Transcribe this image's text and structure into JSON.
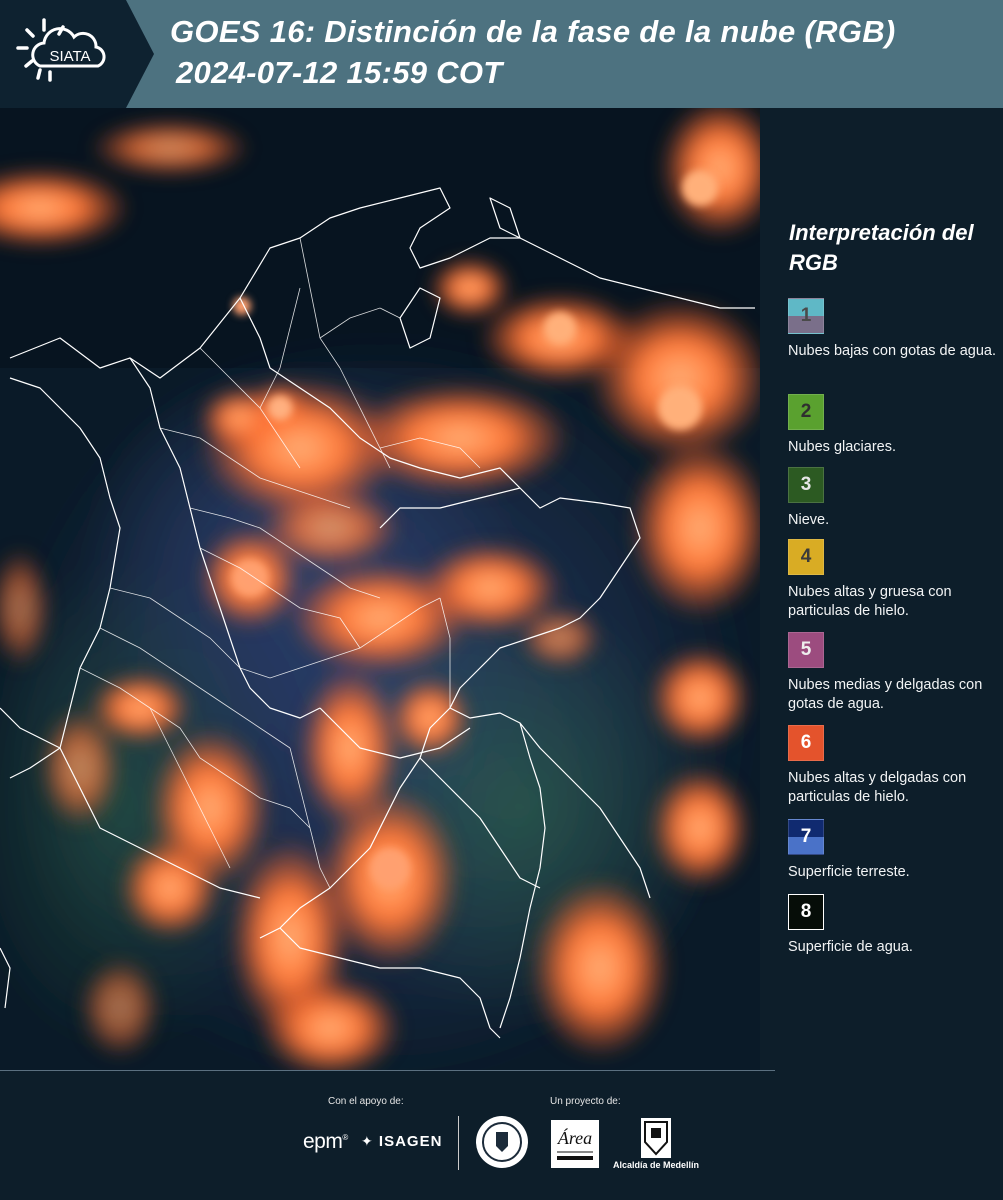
{
  "header": {
    "logo_text": "SIATA",
    "title_line1": "GOES 16: Distinción de la fase de la nube (RGB)",
    "title_line2": "2024-07-12 15:59 COT"
  },
  "legend": {
    "title": "Interpretación del RGB",
    "items": [
      {
        "num": "1",
        "label": "Nubes bajas con gotas de agua.",
        "color_top": "#5fb8c6",
        "color_bottom": "#7a6f8a",
        "num_color": "#4a4a4a"
      },
      {
        "num": "2",
        "label": "Nubes glaciares.",
        "color_top": "#5aa12f",
        "color_bottom": "#5aa12f",
        "num_color": "#2f2f2f"
      },
      {
        "num": "3",
        "label": "Nieve.",
        "color_top": "#2c5a22",
        "color_bottom": "#2c5a22",
        "num_color": "#e6e6e6"
      },
      {
        "num": "4",
        "label": "Nubes altas y gruesa con particulas de hielo.",
        "color_top": "#d9ac24",
        "color_bottom": "#d9ac24",
        "num_color": "#3a3a3a"
      },
      {
        "num": "5",
        "label": "Nubes medias y delgadas con gotas de agua.",
        "color_top": "#9c4c7f",
        "color_bottom": "#9c4c7f",
        "num_color": "#eeeeee"
      },
      {
        "num": "6",
        "label": "Nubes altas y delgadas con particulas de hielo.",
        "color_top": "#e4532c",
        "color_bottom": "#e4532c",
        "num_color": "#ffffff"
      },
      {
        "num": "7",
        "label": "Superficie terreste.",
        "color_top": "#102a70",
        "color_bottom": "#4a72c8",
        "num_color": "#ffffff"
      },
      {
        "num": "8",
        "label": "Superficie de agua.",
        "color_top": "#060d08",
        "color_bottom": "#060d08",
        "num_color": "#ffffff"
      }
    ]
  },
  "footer": {
    "support_label": "Con el apoyo de:",
    "project_label": "Un proyecto de:",
    "epm_logo": "epm",
    "isagen_logo": "ISAGEN",
    "alcaldia_text": "Alcaldía de Medellín"
  },
  "colors": {
    "header_bg": "#4d7280",
    "page_bg": "#0d1e2a",
    "cloud_orange": "#ff6a2a"
  }
}
